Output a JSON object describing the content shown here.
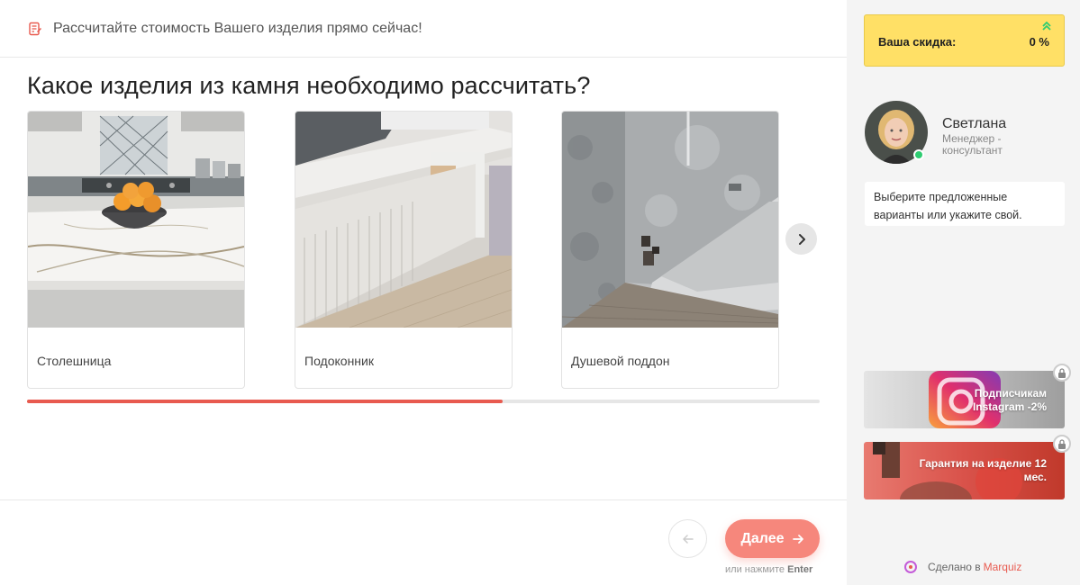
{
  "header": {
    "text": "Рассчитайте стоимость Вашего изделия прямо сейчас!"
  },
  "question": "Какое изделия из камня необходимо рассчитать?",
  "options": [
    {
      "label": "Столешница"
    },
    {
      "label": "Подоконник"
    },
    {
      "label": "Душевой поддон"
    }
  ],
  "progress": {
    "percent": 60
  },
  "nav": {
    "next_label": "Далее",
    "hint_prefix": "или нажмите",
    "hint_key": "Enter"
  },
  "sidebar": {
    "discount_label": "Ваша скидка:",
    "discount_value": "0 %",
    "manager_name": "Светлана",
    "manager_role": "Менеджер - консультант",
    "message": "Выберите предложенные варианты или укажите свой.",
    "bonuses": [
      {
        "text": "Подписчикам Instagram -2%"
      },
      {
        "text": "Гарантия на изделие 12 мес."
      }
    ],
    "made_prefix": "Сделано в",
    "made_brand": "Marquiz"
  },
  "colors": {
    "accent": "#e85a4f",
    "discount_bg": "#ffe066",
    "next_btn": "#f6877c"
  }
}
